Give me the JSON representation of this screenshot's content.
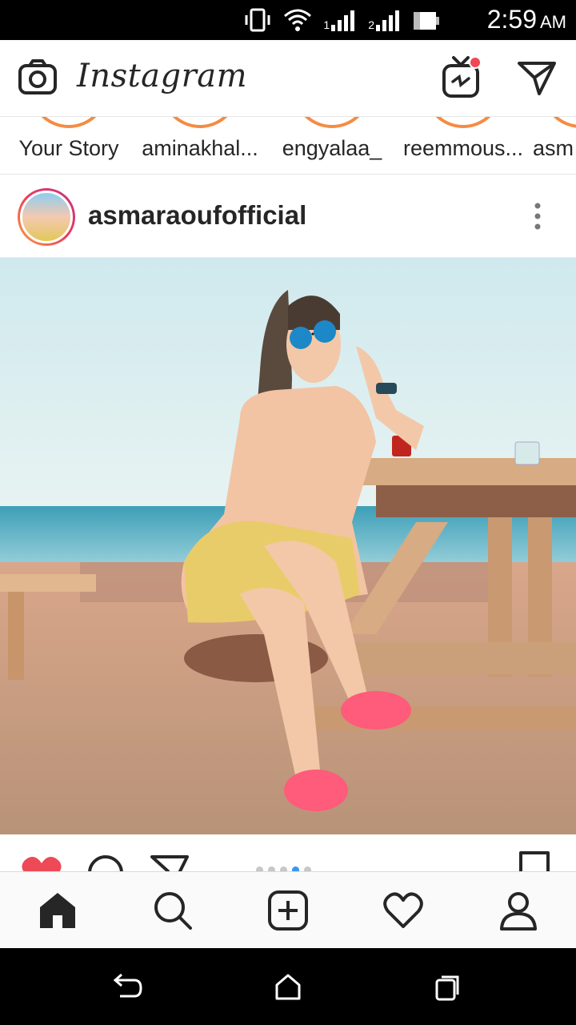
{
  "status_bar": {
    "time": "2:59",
    "ampm": "AM",
    "icons": [
      "vibrate-icon",
      "wifi-icon",
      "signal-1-icon",
      "signal-2-icon",
      "battery-icon"
    ],
    "signal_labels": [
      "1",
      "2"
    ]
  },
  "header": {
    "app_name": "Instagram",
    "icons": [
      "camera-icon",
      "igtv-icon",
      "direct-message-icon"
    ],
    "notification_color": "#ed4956"
  },
  "stories": [
    {
      "username": "Your Story"
    },
    {
      "username": "aminakhal..."
    },
    {
      "username": "engyalaa_"
    },
    {
      "username": "reemmous..."
    },
    {
      "username": "asm"
    }
  ],
  "post": {
    "username": "asmaraoufofficial",
    "carousel": {
      "count": 5,
      "active_index": 3
    }
  },
  "actions": {
    "icons": [
      "heart-filled-icon",
      "comment-icon",
      "share-icon",
      "bookmark-icon"
    ],
    "like_color": "#ed4956",
    "dot_color": "#3897f0"
  },
  "bottom_nav": {
    "items": [
      "home-icon",
      "search-icon",
      "add-post-icon",
      "activity-heart-icon",
      "profile-icon"
    ]
  },
  "android_nav": {
    "items": [
      "back-icon",
      "home-button-icon",
      "recents-icon"
    ]
  },
  "colors": {
    "accent_story": "#f58b42",
    "text": "#262626"
  }
}
